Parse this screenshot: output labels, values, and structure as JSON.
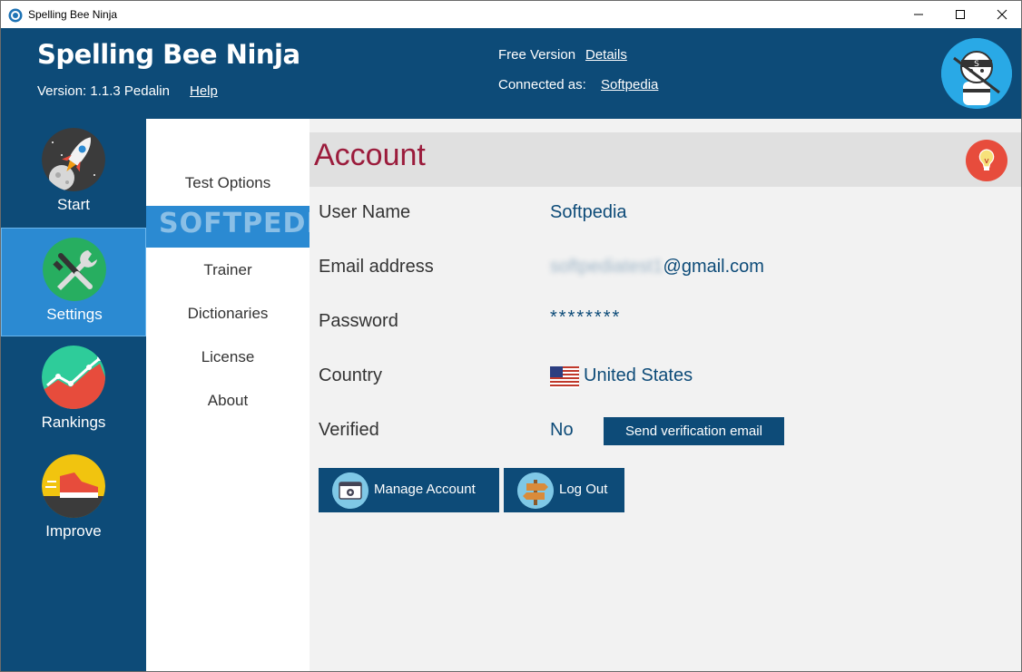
{
  "window": {
    "title": "Spelling Bee Ninja"
  },
  "header": {
    "app_name": "Spelling Bee Ninja",
    "version": "Version: 1.1.3 Pedalin",
    "help": "Help",
    "free_version": "Free Version",
    "details": "Details",
    "connected_as": "Connected as:",
    "user": "Softpedia"
  },
  "nav": {
    "items": [
      {
        "label": "Start",
        "icon": "rocket-icon"
      },
      {
        "label": "Settings",
        "icon": "tools-icon",
        "active": true
      },
      {
        "label": "Rankings",
        "icon": "chart-icon"
      },
      {
        "label": "Improve",
        "icon": "running-shoe-icon"
      }
    ]
  },
  "submenu": {
    "items": [
      {
        "label": "Test Options"
      },
      {
        "label": "Account",
        "active": true
      },
      {
        "label": "Trainer"
      },
      {
        "label": "Dictionaries"
      },
      {
        "label": "License"
      },
      {
        "label": "About"
      }
    ],
    "watermark": "SOFTPEDIA"
  },
  "account": {
    "title": "Account",
    "fields": {
      "username_label": "User Name",
      "username_value": "Softpedia",
      "email_label": "Email address",
      "email_blurred": "softpediatest1",
      "email_domain": "@gmail.com",
      "password_label": "Password",
      "password_value": "********",
      "country_label": "Country",
      "country_value": "United States",
      "verified_label": "Verified",
      "verified_value": "No"
    },
    "send_verification": "Send verification email",
    "manage_account": "Manage Account",
    "log_out": "Log Out"
  },
  "colors": {
    "header_bg": "#0d4b78",
    "active_nav": "#2b8ad2",
    "title_color": "#9b1c3c",
    "content_bg": "#f2f2f2"
  }
}
